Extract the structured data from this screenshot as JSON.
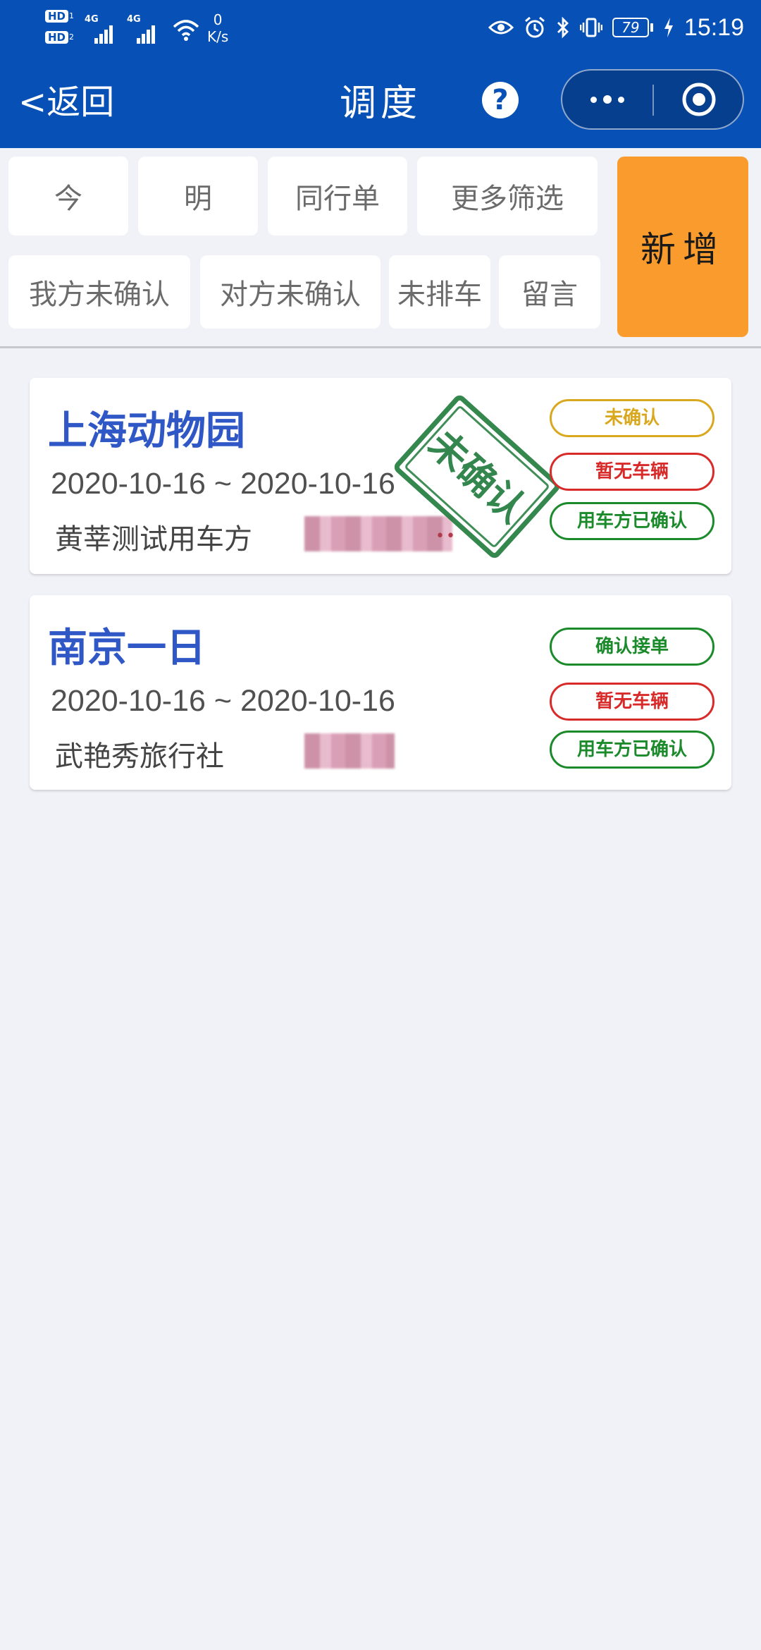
{
  "status_bar": {
    "hd1": "HD",
    "hd2": "HD",
    "sim1": "1",
    "sim2": "2",
    "net1": "4G",
    "net2": "4G",
    "speed_value": "0",
    "speed_unit": "K/s",
    "battery": "79",
    "time": "15:19"
  },
  "nav": {
    "back_label": "<返回",
    "title": "调度",
    "help_icon": "?"
  },
  "filters": {
    "row1": [
      "今",
      "明",
      "同行单",
      "更多筛选"
    ],
    "row2": [
      "我方未确认",
      "对方未确认",
      "未排车",
      "留言"
    ],
    "add_label": "新增"
  },
  "orders": [
    {
      "title": "上海动物园",
      "date_range": "2020-10-16 ~ 2020-10-16",
      "agency": "黄莘测试用车方",
      "stamp": "未确认",
      "badges": [
        {
          "label": "未确认",
          "color": "#d9a81f"
        },
        {
          "label": "暂无车辆",
          "color": "#d92a2a"
        },
        {
          "label": "用车方已确认",
          "color": "#1a8a2a"
        }
      ]
    },
    {
      "title": "南京一日",
      "date_range": "2020-10-16 ~ 2020-10-16",
      "agency": "武艳秀旅行社",
      "badges": [
        {
          "label": "确认接单",
          "color": "#1a8a2a"
        },
        {
          "label": "暂无车辆",
          "color": "#d92a2a"
        },
        {
          "label": "用车方已确认",
          "color": "#1a8a2a"
        }
      ]
    }
  ],
  "colors": {
    "header_blue": "#0750b5",
    "add_orange": "#fa9b2d",
    "title_blue": "#2f58c6",
    "stamp_green": "#1e7a3a"
  }
}
